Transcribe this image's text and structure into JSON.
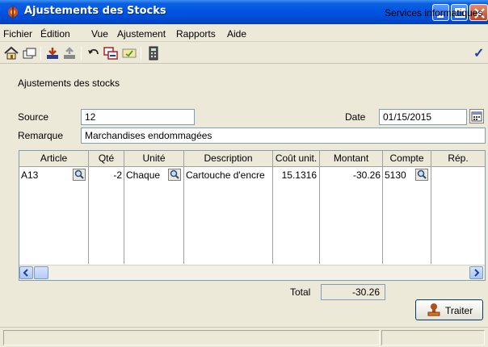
{
  "window": {
    "title": "Ajustements des Stocks"
  },
  "menu": {
    "items": [
      "Fichier",
      "Édition",
      "Vue",
      "Ajustement",
      "Rapports",
      "Aide"
    ]
  },
  "toolbar": {
    "icons": [
      "home-icon",
      "window-icon",
      "save-icon",
      "export-icon",
      "undo-icon",
      "copy-window-icon",
      "edit-icon",
      "calculator-icon",
      "checkmark-icon"
    ],
    "confirm_glyph": "✓"
  },
  "form": {
    "heading": "Ajustements des stocks",
    "source_label": "Source",
    "source_value": "12",
    "date_label": "Date",
    "date_value": "01/15/2015",
    "remark_label": "Remarque",
    "remark_value": "Marchandises endommagées"
  },
  "grid": {
    "columns": [
      "Article",
      "Qté",
      "Unité",
      "Description",
      "Coût unit.",
      "Montant",
      "Compte",
      "Rép."
    ],
    "rows": [
      {
        "article": "A13",
        "qty": "-2",
        "unit": "Chaque",
        "description": "Cartouche d'encre",
        "unit_cost": "15.1316",
        "amount": "-30.26",
        "account": "5130",
        "rep": ""
      }
    ]
  },
  "totals": {
    "label": "Total",
    "value": "-30.26"
  },
  "actions": {
    "process_label": "Traiter"
  },
  "status": {
    "text": "Services informatiques"
  },
  "colors": {
    "titlebar": "#0054e3",
    "window_bg": "#ece9d8",
    "accent": "#1b3fa6"
  }
}
